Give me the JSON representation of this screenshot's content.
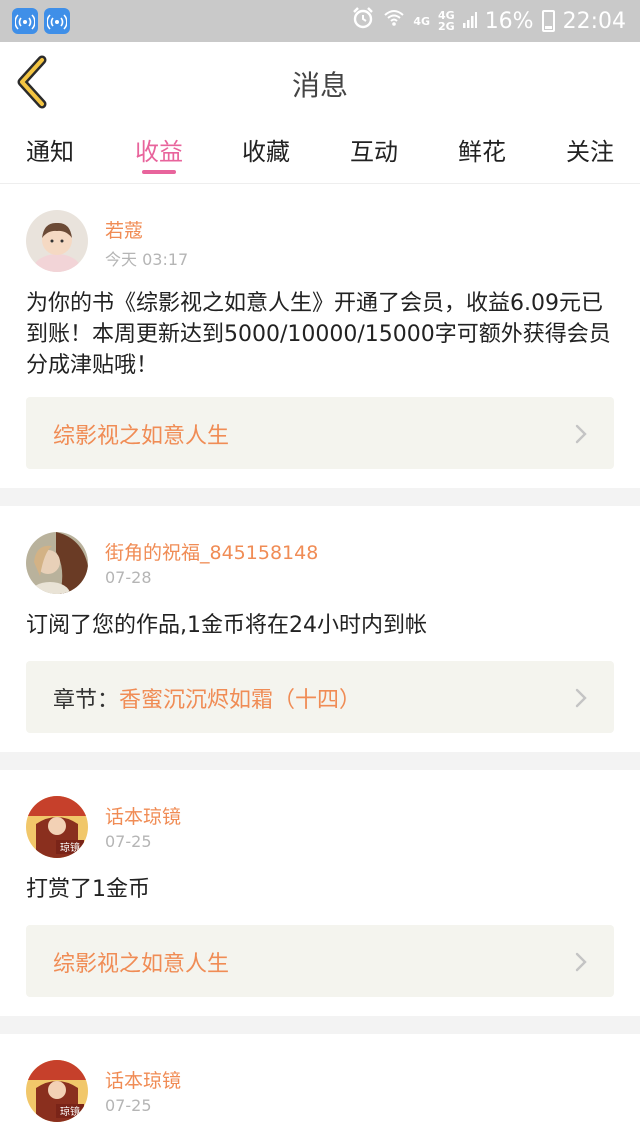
{
  "status_bar": {
    "network_top": "4G",
    "network_bottom": "2G",
    "network_label_mid": "4G",
    "battery": "16%",
    "time": "22:04"
  },
  "header": {
    "title": "消息"
  },
  "tabs": [
    {
      "label": "通知",
      "active": false
    },
    {
      "label": "收益",
      "active": true
    },
    {
      "label": "收藏",
      "active": false
    },
    {
      "label": "互动",
      "active": false
    },
    {
      "label": "鲜花",
      "active": false
    },
    {
      "label": "关注",
      "active": false
    }
  ],
  "colors": {
    "accent": "#e8649c",
    "username": "#f08c55",
    "link_box_bg": "#f4f4ee",
    "separator": "#f3f3f3"
  },
  "feed": [
    {
      "username": "若蔻",
      "time": "今天 03:17",
      "message": "为你的书《综影视之如意人生》开通了会员，收益6.09元已到账！本周更新达到5000/10000/15000字可额外获得会员分成津贴哦！",
      "link_prefix": "",
      "link": "综影视之如意人生"
    },
    {
      "username": "街角的祝福_845158148",
      "time": "07-28",
      "message": "订阅了您的作品,1金币将在24小时内到帐",
      "link_prefix": "章节：",
      "link": "香蜜沉沉烬如霜（十四）"
    },
    {
      "username": "话本琼镜",
      "time": "07-25",
      "message": "打赏了1金币",
      "link_prefix": "",
      "link": "综影视之如意人生"
    },
    {
      "username": "话本琼镜",
      "time": "07-25",
      "avatar_text": "琼镜"
    }
  ]
}
